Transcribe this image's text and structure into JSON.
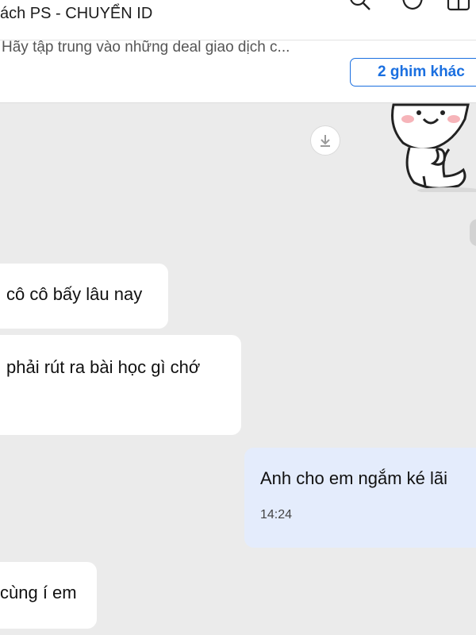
{
  "header": {
    "title": "ách PS - CHUYỂN ID",
    "icons": [
      "search-icon",
      "video-call-icon",
      "split-view-icon"
    ]
  },
  "pinned": {
    "text": "Hãy tập trung vào những deal giao dịch c...",
    "button_label": "2 ghim khác"
  },
  "chat": {
    "download_icon": "download-icon",
    "sticker": "cute-sticker",
    "messages": [
      {
        "side": "left",
        "text": "cô cô bấy lâu nay"
      },
      {
        "side": "left",
        "text": "phải rút ra bài học gì chớ"
      },
      {
        "side": "right",
        "text": "Anh cho em ngắm ké lãi",
        "time": "14:24"
      },
      {
        "side": "left",
        "text": "cùng í em"
      }
    ]
  },
  "colors": {
    "accent": "#1a6fe0",
    "chat_bg": "#ebebeb",
    "sent_bubble": "#e4ecfc"
  }
}
